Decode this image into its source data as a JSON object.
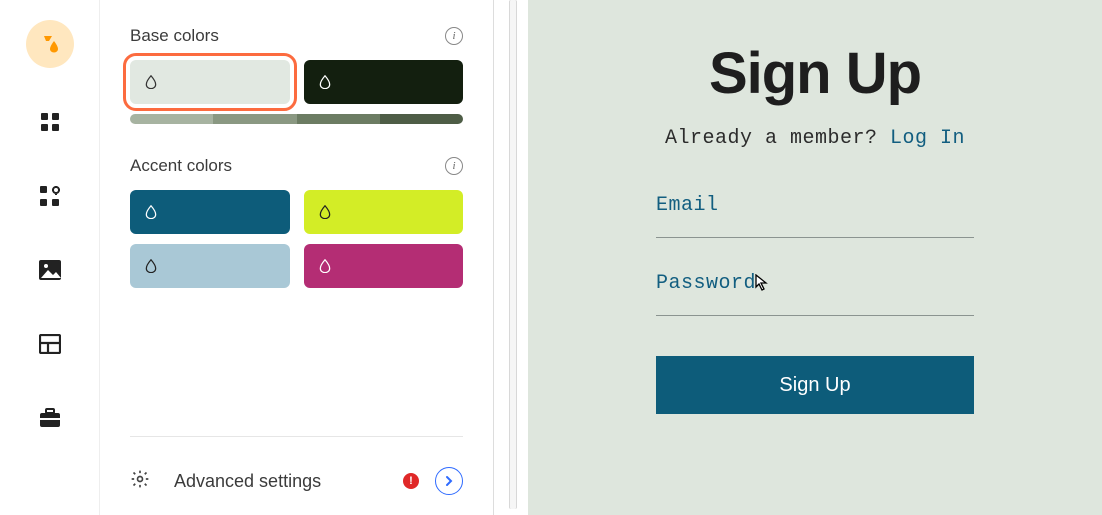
{
  "panel": {
    "base_label": "Base colors",
    "accent_label": "Accent colors",
    "advanced_label": "Advanced settings",
    "base_swatches": [
      {
        "color": "#e1e8e1",
        "drop": "#333",
        "selected": true
      },
      {
        "color": "#131f0f",
        "drop": "#fff",
        "selected": false
      }
    ],
    "base_shades": [
      "#a7b3a1",
      "#8a9882",
      "#6c7c63",
      "#4e5d46"
    ],
    "accent_swatches": [
      {
        "color": "#0d5c7a",
        "drop": "#fff"
      },
      {
        "color": "#d3ed26",
        "drop": "#222"
      },
      {
        "color": "#a9c8d6",
        "drop": "#222"
      },
      {
        "color": "#b42d74",
        "drop": "#fff"
      }
    ]
  },
  "preview": {
    "heading": "Sign Up",
    "member_text": "Already a member? ",
    "login_link": "Log In",
    "email_label": "Email",
    "password_label": "Password",
    "button_label": "Sign Up"
  }
}
